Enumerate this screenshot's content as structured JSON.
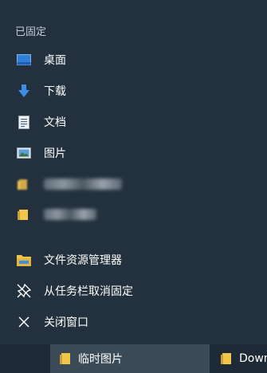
{
  "jumplist": {
    "section_title": "已固定",
    "pinned": [
      {
        "label": "桌面",
        "icon": "desktop-icon"
      },
      {
        "label": "下载",
        "icon": "download-icon"
      },
      {
        "label": "文档",
        "icon": "document-icon"
      },
      {
        "label": "图片",
        "icon": "pictures-icon"
      },
      {
        "label": "",
        "icon": "folder-icon",
        "blurred": true
      },
      {
        "label": "",
        "icon": "folder-icon",
        "blurred": true
      }
    ],
    "actions": [
      {
        "label": "文件资源管理器",
        "icon": "file-explorer-icon"
      },
      {
        "label": "从任务栏取消固定",
        "icon": "unpin-icon"
      },
      {
        "label": "关闭窗口",
        "icon": "close-icon"
      }
    ]
  },
  "taskbar": {
    "items": [
      {
        "label": "临时图片",
        "icon": "folder-icon",
        "active": true
      },
      {
        "label": "Downl",
        "icon": "folder-icon",
        "active": false
      }
    ]
  },
  "colors": {
    "menu_background": "#22313d",
    "taskbar_background": "#1e2a35",
    "active_taskbar_item": "#3a4a57",
    "folder_yellow": "#f1c74b",
    "accent_blue": "#3c8ee6"
  }
}
